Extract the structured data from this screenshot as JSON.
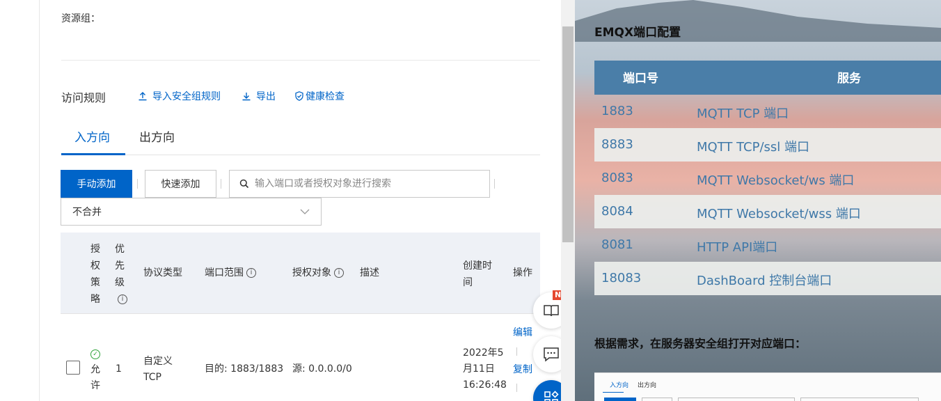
{
  "left": {
    "resource_group_label": "资源组：",
    "rules_title": "访问规则",
    "toolbar": {
      "import_label": "导入安全组规则",
      "export_label": "导出",
      "health_label": "健康检查"
    },
    "tabs": {
      "inbound": "入方向",
      "outbound": "出方向"
    },
    "actions": {
      "manual_add": "手动添加",
      "quick_add": "快速添加",
      "search_placeholder": "输入端口或者授权对象进行搜索",
      "merge_select": "不合并"
    },
    "table": {
      "headers": {
        "policy": [
          "授",
          "权",
          "策",
          "略"
        ],
        "priority": [
          "优",
          "先",
          "级"
        ],
        "protocol": "协议类型",
        "port_range": "端口范围",
        "auth_object": "授权对象",
        "description": "描述",
        "created_at": [
          "创建时",
          "间"
        ],
        "operation": "操作"
      },
      "row": {
        "policy": [
          "允",
          "许"
        ],
        "priority": "1",
        "protocol": [
          "自定义",
          "TCP"
        ],
        "port_range": "目的: 1883/1883",
        "auth_object": "源: 0.0.0.0/0",
        "created_at": [
          "2022年5",
          "月11日",
          "16:26:48"
        ],
        "edit": "编辑",
        "copy": "复制"
      }
    },
    "new_badge": "NEW"
  },
  "right": {
    "title": "EMQX端口配置",
    "table_headers": {
      "port": "端口号",
      "service": "服务"
    },
    "rows": [
      {
        "port": "1883",
        "service": "MQTT TCP 端口"
      },
      {
        "port": "8883",
        "service": "MQTT TCP/ssl 端口"
      },
      {
        "port": "8083",
        "service": "MQTT Websocket/ws 端口"
      },
      {
        "port": "8084",
        "service": "MQTT Websocket/wss 端口"
      },
      {
        "port": "8081",
        "service": "HTTP API端口"
      },
      {
        "port": "18083",
        "service": "DashBoard 控制台端口"
      }
    ],
    "note": "根据需求，在服务器安全组打开对应端口：",
    "mini_tabs": {
      "inbound": "入方向",
      "outbound": "出方向"
    }
  },
  "colors": {
    "accent": "#0064c8",
    "table_header": "#4a7ea8",
    "port_text": "#3f78a8",
    "success": "#2fa33a",
    "badge": "#e5482f"
  }
}
